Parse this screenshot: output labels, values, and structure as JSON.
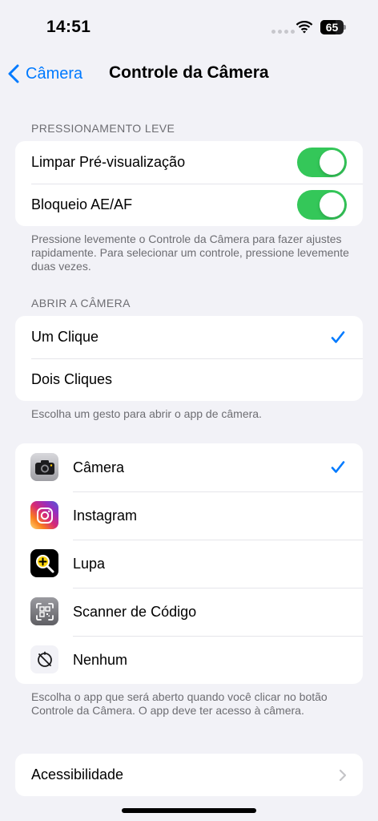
{
  "status_bar": {
    "time": "14:51",
    "battery": "65",
    "battery_level": 0.65
  },
  "nav": {
    "back_label": "Câmera",
    "title": "Controle da Câmera"
  },
  "light_press": {
    "header": "PRESSIONAMENTO LEVE",
    "items": [
      {
        "label": "Limpar Pré-visualização",
        "on": true
      },
      {
        "label": "Bloqueio AE/AF",
        "on": true
      }
    ],
    "footer": "Pressione levemente o Controle da Câmera para fazer ajustes rapidamente. Para selecionar um controle, pressione levemente duas vezes."
  },
  "open_camera": {
    "header": "ABRIR A CÂMERA",
    "items": [
      {
        "label": "Um Clique",
        "selected": true
      },
      {
        "label": "Dois Cliques",
        "selected": false
      }
    ],
    "footer": "Escolha um gesto para abrir o app de câmera."
  },
  "apps": {
    "items": [
      {
        "label": "Câmera",
        "icon": "camera-app-icon",
        "selected": true
      },
      {
        "label": "Instagram",
        "icon": "instagram-app-icon",
        "selected": false
      },
      {
        "label": "Lupa",
        "icon": "magnifier-app-icon",
        "selected": false
      },
      {
        "label": "Scanner de Código",
        "icon": "code-scanner-app-icon",
        "selected": false
      },
      {
        "label": "Nenhum",
        "icon": "none-icon",
        "selected": false
      }
    ],
    "footer": "Escolha o app que será aberto quando você clicar no botão Controle da Câmera. O app deve ter acesso à câmera."
  },
  "accessibility": {
    "label": "Acessibilidade"
  },
  "colors": {
    "accent": "#007aff",
    "toggle_on": "#34c759",
    "background": "#f2f2f7"
  }
}
